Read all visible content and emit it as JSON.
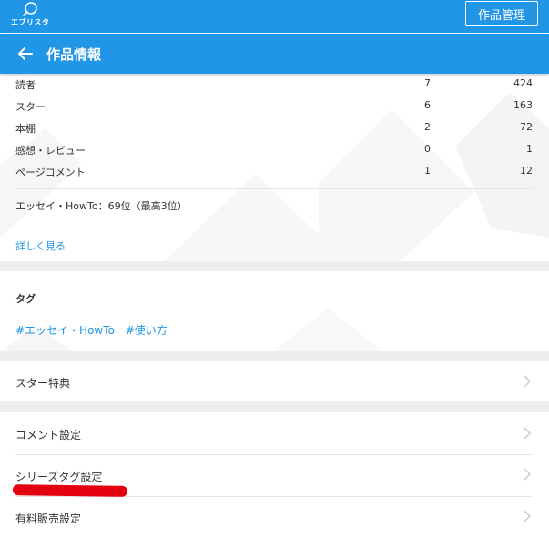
{
  "topbar": {
    "logo_text": "エブリスタ",
    "logo_icon": "search-bubble-icon",
    "manage_label": "作品管理"
  },
  "header": {
    "back_icon": "arrow-left-icon",
    "title": "作品情報"
  },
  "stats": [
    {
      "label": "読者",
      "value1": "7",
      "value2": "424"
    },
    {
      "label": "スター",
      "value1": "6",
      "value2": "163"
    },
    {
      "label": "本棚",
      "value1": "2",
      "value2": "72"
    },
    {
      "label": "感想・レビュー",
      "value1": "0",
      "value2": "1"
    },
    {
      "label": "ページコメント",
      "value1": "1",
      "value2": "12"
    }
  ],
  "ranking": "エッセイ・HowTo：69位（最高3位）",
  "detail_link": "詳しく見る",
  "tags": {
    "heading": "タグ",
    "items": [
      "#エッセイ・HowTo",
      "#使い方"
    ]
  },
  "menu": {
    "star_benefit": "スター特典",
    "comment_settings": "コメント設定",
    "series_tag_settings": "シリーズタグ設定",
    "paid_sales_settings": "有料販売設定",
    "chevron_icon": "chevron-right-icon"
  },
  "colors": {
    "brand_blue": "#2196e6",
    "link_blue": "#2196e6",
    "highlight_red": "#e3000f"
  }
}
